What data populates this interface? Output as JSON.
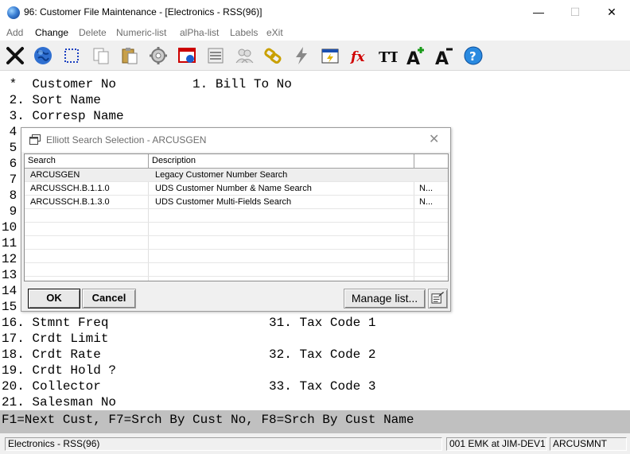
{
  "window": {
    "title": "96: Customer File Maintenance - [Electronics - RSS(96)]",
    "minimize": "—",
    "maximize": "☐",
    "close": "✕"
  },
  "menu": [
    "Add",
    "Change",
    "Delete",
    "Numeric-list",
    "alPha-list",
    "Labels",
    "eXit"
  ],
  "menu_active": "Change",
  "toolbar_icons": [
    "exit-icon",
    "globe-icon",
    "select-icon",
    "copy-icon",
    "paste-icon",
    "settings-icon",
    "report-icon",
    "list-icon",
    "users-icon",
    "link-icon",
    "lightning-icon",
    "calendar-icon",
    "function-icon",
    "font-icon",
    "font-increase-icon",
    "font-decrease-icon",
    "help-icon"
  ],
  "toolbar_glyphs": {
    "function": "fx",
    "font": "TT",
    "font_increase": "A",
    "font_decrease": "A",
    "help": "?"
  },
  "terminal_lines": [
    " *  Customer No          1. Bill To No",
    " 2. Sort Name",
    " 3. Corresp Name",
    " 4",
    " 5",
    " 6",
    " 7",
    " 8",
    " 9",
    "10",
    "11",
    "12",
    "13",
    "14",
    "15",
    "16. Stmnt Freq                     31. Tax Code 1",
    "17. Crdt Limit",
    "18. Crdt Rate                      32. Tax Code 2",
    "19. Crdt Hold ?",
    "20. Collector                      33. Tax Code 3",
    "21. Salesman No"
  ],
  "function_keys": "F1=Next Cust, F7=Srch By Cust No, F8=Srch By Cust Name",
  "status": {
    "company": "Electronics - RSS(96)",
    "session": "001 EMK at JIM-DEV1",
    "program": "ARCUSMNT"
  },
  "dialog": {
    "title": "Elliott Search Selection - ARCUSGEN",
    "close": "✕",
    "columns": [
      "Search",
      "Description",
      ""
    ],
    "rows": [
      {
        "search": "ARCUSGEN",
        "description": "Legacy Customer Number Search",
        "extra": ""
      },
      {
        "search": "ARCUSSCH.B.1.1.0",
        "description": "UDS Customer Number & Name Search",
        "extra": "N..."
      },
      {
        "search": "ARCUSSCH.B.1.3.0",
        "description": "UDS Customer Multi-Fields Search",
        "extra": "N..."
      }
    ],
    "selected_row": 0,
    "ok_label": "OK",
    "cancel_label": "Cancel",
    "manage_label": "Manage list..."
  }
}
